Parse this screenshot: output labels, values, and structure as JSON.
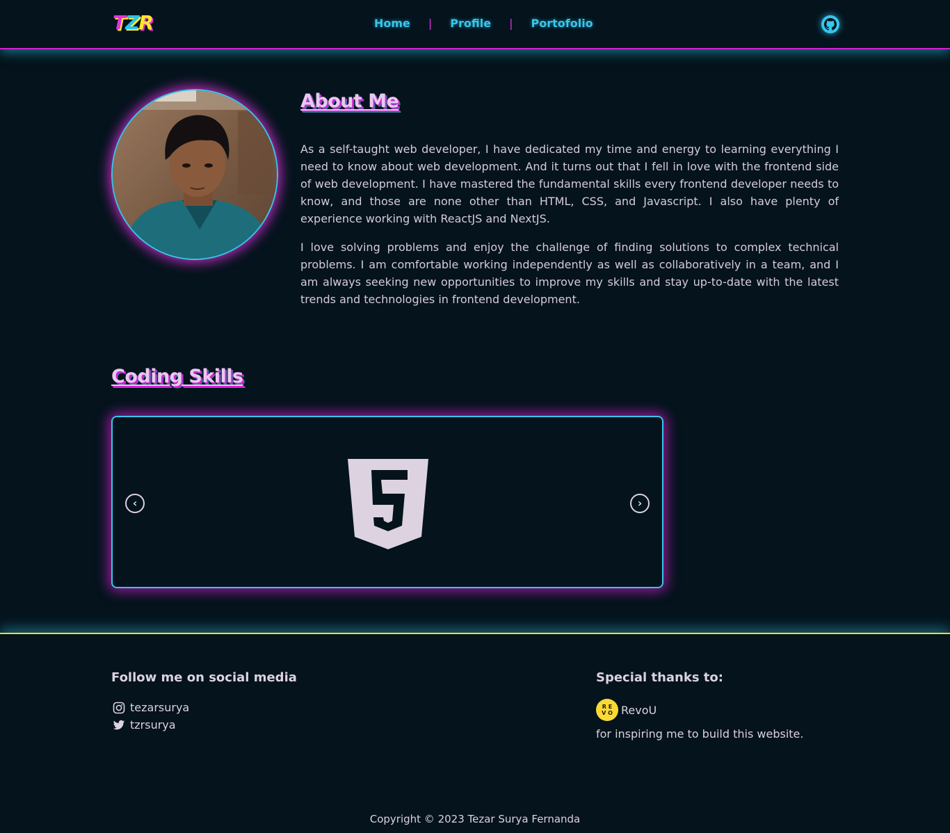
{
  "nav": {
    "logo": [
      "T",
      "Z",
      "R"
    ],
    "links": [
      "Home",
      "Profile",
      "Portofolio"
    ],
    "separator": "|",
    "github_icon": "github-icon"
  },
  "about": {
    "title": "About Me",
    "paragraphs": [
      "As a self-taught web developer, I have dedicated my time and energy to learning everything I need to know about web development. And it turns out that I fell in love with the frontend side of web development. I have mastered the fundamental skills every frontend developer needs to know, and those are none other than HTML, CSS, and Javascript. I also have plenty of experience working with ReactJS and NextJS.",
      "I love solving problems and enjoy the challenge of finding solutions to complex technical problems. I am comfortable working independently as well as collaboratively in a team, and I am always seeking new opportunities to improve my skills and stay up-to-date with the latest trends and technologies in frontend development."
    ]
  },
  "skills": {
    "title": "Coding Skills",
    "carousel": {
      "current_icon": "html5-icon",
      "prev_icon": "chevron-left-icon",
      "next_icon": "chevron-right-icon",
      "prev_glyph": "‹",
      "next_glyph": "›"
    }
  },
  "footer": {
    "follow_heading": "Follow me on social media",
    "socials": [
      {
        "icon": "instagram-icon",
        "handle": "tezarsurya"
      },
      {
        "icon": "twitter-icon",
        "handle": "tzrsurya"
      }
    ],
    "thanks_heading": "Special thanks to:",
    "thanks_name": "RevoU",
    "thanks_note": "for inspiring me to build this website.",
    "copyright": "Copyright © 2023 Tezar Surya Fernanda"
  },
  "colors": {
    "background": "#04131c",
    "magenta": "#d61fd6",
    "cyan": "#37c6ec",
    "yellow": "#f2e01c",
    "text": "#dcd2e0"
  }
}
